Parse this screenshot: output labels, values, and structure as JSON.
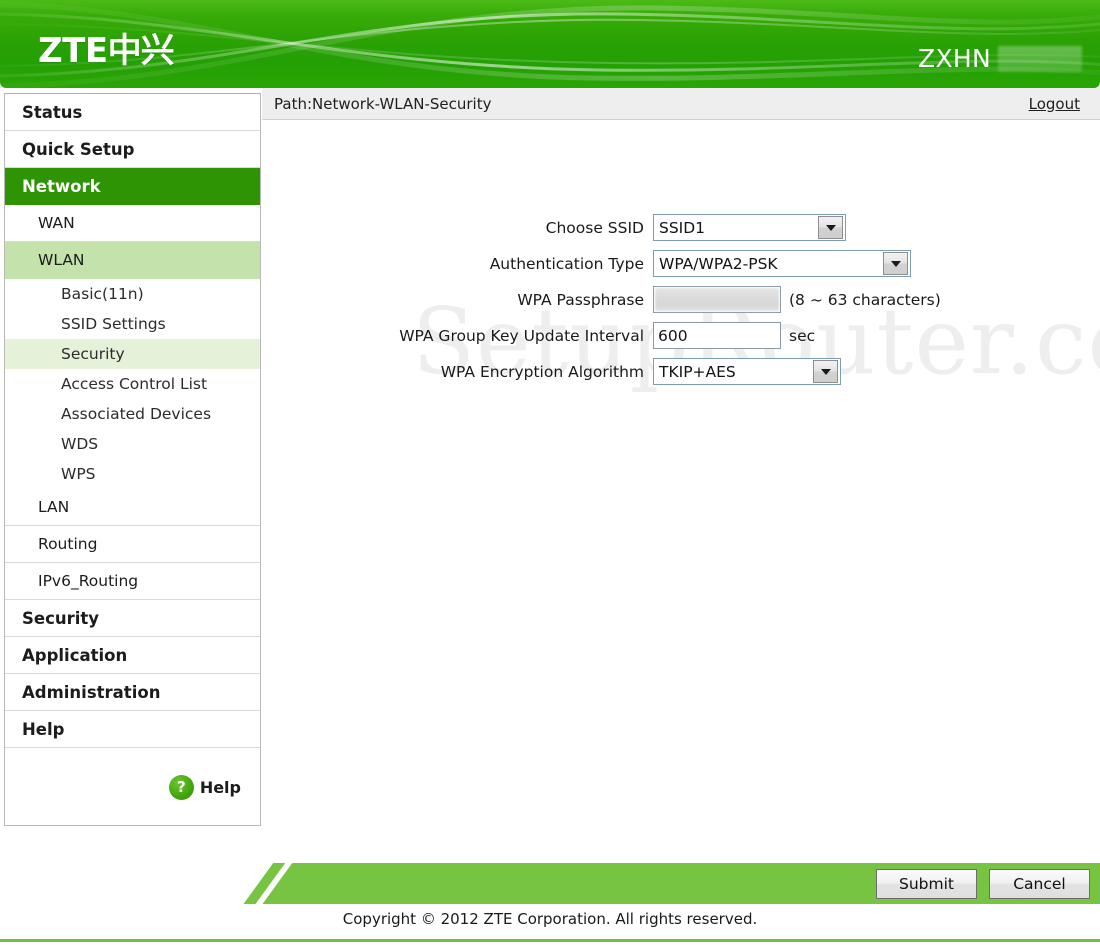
{
  "header": {
    "brand_latin": "ZTE",
    "brand_cn": "中兴",
    "model": "ZXHN",
    "model_redacted": true,
    "gradient_from": "#4cbb17",
    "gradient_to": "#2ba505"
  },
  "sidebar": {
    "items": [
      {
        "label": "Status",
        "level": "top",
        "state": "normal"
      },
      {
        "label": "Quick Setup",
        "level": "top",
        "state": "normal"
      },
      {
        "label": "Network",
        "level": "top",
        "state": "active"
      },
      {
        "label": "WAN",
        "level": "sub",
        "state": "normal"
      },
      {
        "label": "WLAN",
        "level": "sub",
        "state": "open"
      },
      {
        "label": "Basic(11n)",
        "level": "subsub",
        "state": "normal"
      },
      {
        "label": "SSID Settings",
        "level": "subsub",
        "state": "normal"
      },
      {
        "label": "Security",
        "level": "subsub",
        "state": "selected"
      },
      {
        "label": "Access Control List",
        "level": "subsub",
        "state": "normal"
      },
      {
        "label": "Associated Devices",
        "level": "subsub",
        "state": "normal"
      },
      {
        "label": "WDS",
        "level": "subsub",
        "state": "normal"
      },
      {
        "label": "WPS",
        "level": "subsub",
        "state": "normal"
      },
      {
        "label": "LAN",
        "level": "sub",
        "state": "normal"
      },
      {
        "label": "Routing",
        "level": "sub",
        "state": "normal"
      },
      {
        "label": "IPv6_Routing",
        "level": "sub",
        "state": "normal"
      },
      {
        "label": "Security",
        "level": "top",
        "state": "normal"
      },
      {
        "label": "Application",
        "level": "top",
        "state": "normal"
      },
      {
        "label": "Administration",
        "level": "top",
        "state": "normal"
      },
      {
        "label": "Help",
        "level": "top",
        "state": "normal"
      }
    ],
    "help_button": {
      "icon": "question-mark-circle-icon",
      "glyph": "?",
      "label": "Help"
    },
    "active_color": "#2e9404",
    "open_color": "#c3e3ab",
    "selected_color": "#e6f1da"
  },
  "main": {
    "path": "Path:Network-WLAN-Security",
    "logout_label": "Logout",
    "watermark": "SetupRouter.co",
    "form": {
      "choose_ssid": {
        "label": "Choose SSID",
        "value": "SSID1",
        "control": "select"
      },
      "authentication_type": {
        "label": "Authentication Type",
        "value": "WPA/WPA2-PSK",
        "control": "select"
      },
      "wpa_passphrase": {
        "label": "WPA Passphrase",
        "value": "",
        "redacted": true,
        "hint": "(8 ~ 63 characters)",
        "control": "password"
      },
      "wpa_group_key_update_interval": {
        "label": "WPA Group Key Update Interval",
        "value": "600",
        "unit": "sec",
        "control": "text"
      },
      "wpa_encryption_algorithm": {
        "label": "WPA Encryption Algorithm",
        "value": "TKIP+AES",
        "control": "select"
      }
    }
  },
  "footer": {
    "submit_label": "Submit",
    "cancel_label": "Cancel",
    "copyright": "Copyright © 2012 ZTE Corporation. All rights reserved.",
    "bar_color": "#76c442"
  }
}
